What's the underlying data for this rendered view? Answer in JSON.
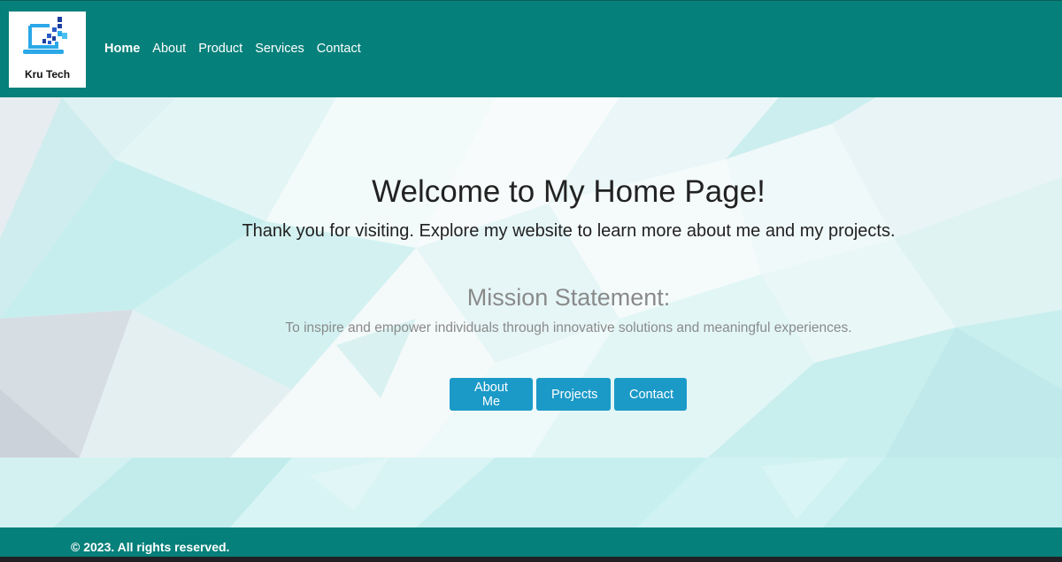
{
  "brand": {
    "name": "Kru Tech",
    "logo_icon": "laptop-pixels-icon",
    "colors": {
      "header": "#06807a",
      "button": "#1b9ac8",
      "logo_blue": "#2aa8e8"
    }
  },
  "nav": {
    "items": [
      {
        "label": "Home",
        "active": true
      },
      {
        "label": "About",
        "active": false
      },
      {
        "label": "Product",
        "active": false
      },
      {
        "label": "Services",
        "active": false
      },
      {
        "label": "Contact",
        "active": false
      }
    ]
  },
  "hero": {
    "title": "Welcome to My Home Page!",
    "subtitle": "Thank you for visiting. Explore my website to learn more about me and my projects.",
    "mission_title": "Mission Statement:",
    "mission_text": "To inspire and empower individuals through innovative solutions and meaningful experiences.",
    "buttons": {
      "about": "About Me",
      "projects": "Projects",
      "contact": "Contact"
    }
  },
  "footer": {
    "text": "© 2023. All rights reserved."
  }
}
